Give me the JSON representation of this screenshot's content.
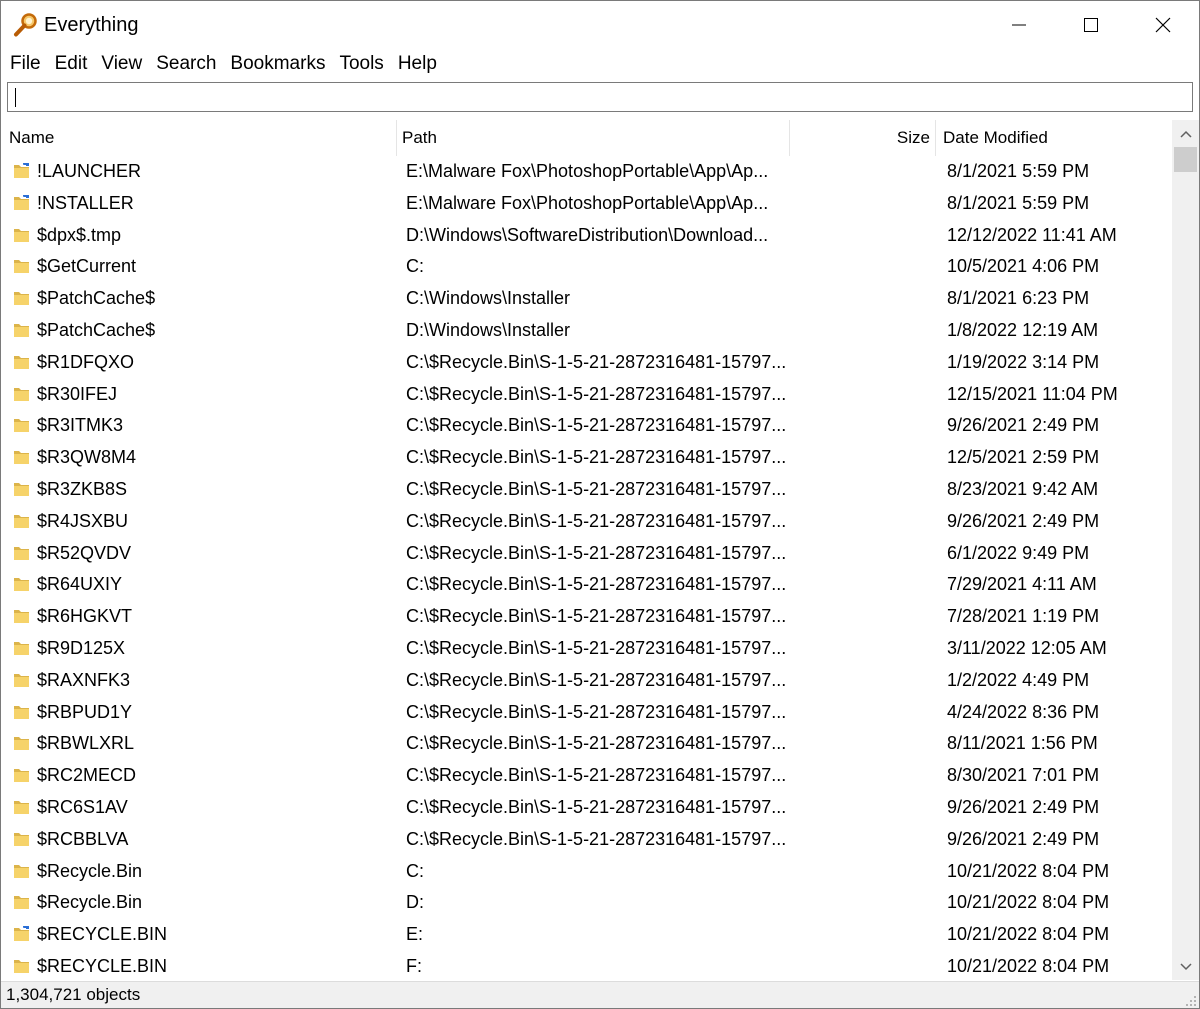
{
  "window": {
    "title": "Everything",
    "accent_color": "#e8a317"
  },
  "menubar": {
    "items": [
      "File",
      "Edit",
      "View",
      "Search",
      "Bookmarks",
      "Tools",
      "Help"
    ]
  },
  "search": {
    "value": "",
    "placeholder": ""
  },
  "columns": {
    "name": "Name",
    "path": "Path",
    "size": "Size",
    "date": "Date Modified"
  },
  "rows": [
    {
      "name": "!LAUNCHER",
      "path": "E:\\Malware Fox\\PhotoshopPortable\\App\\Ap...",
      "size": "",
      "date": "8/1/2021 5:59 PM",
      "icon": "folder-shortcut-icon"
    },
    {
      "name": "!NSTALLER",
      "path": "E:\\Malware Fox\\PhotoshopPortable\\App\\Ap...",
      "size": "",
      "date": "8/1/2021 5:59 PM",
      "icon": "folder-shortcut-icon"
    },
    {
      "name": "$dpx$.tmp",
      "path": "D:\\Windows\\SoftwareDistribution\\Download...",
      "size": "",
      "date": "12/12/2022 11:41 AM",
      "icon": "folder-icon"
    },
    {
      "name": "$GetCurrent",
      "path": "C:",
      "size": "",
      "date": "10/5/2021 4:06 PM",
      "icon": "folder-icon"
    },
    {
      "name": "$PatchCache$",
      "path": "C:\\Windows\\Installer",
      "size": "",
      "date": "8/1/2021 6:23 PM",
      "icon": "folder-icon"
    },
    {
      "name": "$PatchCache$",
      "path": "D:\\Windows\\Installer",
      "size": "",
      "date": "1/8/2022 12:19 AM",
      "icon": "folder-icon"
    },
    {
      "name": "$R1DFQXO",
      "path": "C:\\$Recycle.Bin\\S-1-5-21-2872316481-15797...",
      "size": "",
      "date": "1/19/2022 3:14 PM",
      "icon": "folder-icon"
    },
    {
      "name": "$R30IFEJ",
      "path": "C:\\$Recycle.Bin\\S-1-5-21-2872316481-15797...",
      "size": "",
      "date": "12/15/2021 11:04 PM",
      "icon": "folder-icon"
    },
    {
      "name": "$R3ITMK3",
      "path": "C:\\$Recycle.Bin\\S-1-5-21-2872316481-15797...",
      "size": "",
      "date": "9/26/2021 2:49 PM",
      "icon": "folder-icon"
    },
    {
      "name": "$R3QW8M4",
      "path": "C:\\$Recycle.Bin\\S-1-5-21-2872316481-15797...",
      "size": "",
      "date": "12/5/2021 2:59 PM",
      "icon": "folder-icon"
    },
    {
      "name": "$R3ZKB8S",
      "path": "C:\\$Recycle.Bin\\S-1-5-21-2872316481-15797...",
      "size": "",
      "date": "8/23/2021 9:42 AM",
      "icon": "folder-icon"
    },
    {
      "name": "$R4JSXBU",
      "path": "C:\\$Recycle.Bin\\S-1-5-21-2872316481-15797...",
      "size": "",
      "date": "9/26/2021 2:49 PM",
      "icon": "folder-icon"
    },
    {
      "name": "$R52QVDV",
      "path": "C:\\$Recycle.Bin\\S-1-5-21-2872316481-15797...",
      "size": "",
      "date": "6/1/2022 9:49 PM",
      "icon": "folder-icon"
    },
    {
      "name": "$R64UXIY",
      "path": "C:\\$Recycle.Bin\\S-1-5-21-2872316481-15797...",
      "size": "",
      "date": "7/29/2021 4:11 AM",
      "icon": "folder-icon"
    },
    {
      "name": "$R6HGKVT",
      "path": "C:\\$Recycle.Bin\\S-1-5-21-2872316481-15797...",
      "size": "",
      "date": "7/28/2021 1:19 PM",
      "icon": "folder-icon"
    },
    {
      "name": "$R9D125X",
      "path": "C:\\$Recycle.Bin\\S-1-5-21-2872316481-15797...",
      "size": "",
      "date": "3/11/2022 12:05 AM",
      "icon": "folder-icon"
    },
    {
      "name": "$RAXNFK3",
      "path": "C:\\$Recycle.Bin\\S-1-5-21-2872316481-15797...",
      "size": "",
      "date": "1/2/2022 4:49 PM",
      "icon": "folder-icon"
    },
    {
      "name": "$RBPUD1Y",
      "path": "C:\\$Recycle.Bin\\S-1-5-21-2872316481-15797...",
      "size": "",
      "date": "4/24/2022 8:36 PM",
      "icon": "folder-icon"
    },
    {
      "name": "$RBWLXRL",
      "path": "C:\\$Recycle.Bin\\S-1-5-21-2872316481-15797...",
      "size": "",
      "date": "8/11/2021 1:56 PM",
      "icon": "folder-icon"
    },
    {
      "name": "$RC2MECD",
      "path": "C:\\$Recycle.Bin\\S-1-5-21-2872316481-15797...",
      "size": "",
      "date": "8/30/2021 7:01 PM",
      "icon": "folder-icon"
    },
    {
      "name": "$RC6S1AV",
      "path": "C:\\$Recycle.Bin\\S-1-5-21-2872316481-15797...",
      "size": "",
      "date": "9/26/2021 2:49 PM",
      "icon": "folder-icon"
    },
    {
      "name": "$RCBBLVA",
      "path": "C:\\$Recycle.Bin\\S-1-5-21-2872316481-15797...",
      "size": "",
      "date": "9/26/2021 2:49 PM",
      "icon": "folder-icon"
    },
    {
      "name": "$Recycle.Bin",
      "path": "C:",
      "size": "",
      "date": "10/21/2022 8:04 PM",
      "icon": "folder-icon"
    },
    {
      "name": "$Recycle.Bin",
      "path": "D:",
      "size": "",
      "date": "10/21/2022 8:04 PM",
      "icon": "folder-icon"
    },
    {
      "name": "$RECYCLE.BIN",
      "path": "E:",
      "size": "",
      "date": "10/21/2022 8:04 PM",
      "icon": "folder-shortcut-icon"
    },
    {
      "name": "$RECYCLE.BIN",
      "path": "F:",
      "size": "",
      "date": "10/21/2022 8:04 PM",
      "icon": "folder-icon"
    }
  ],
  "status": {
    "text": "1,304,721 objects"
  }
}
